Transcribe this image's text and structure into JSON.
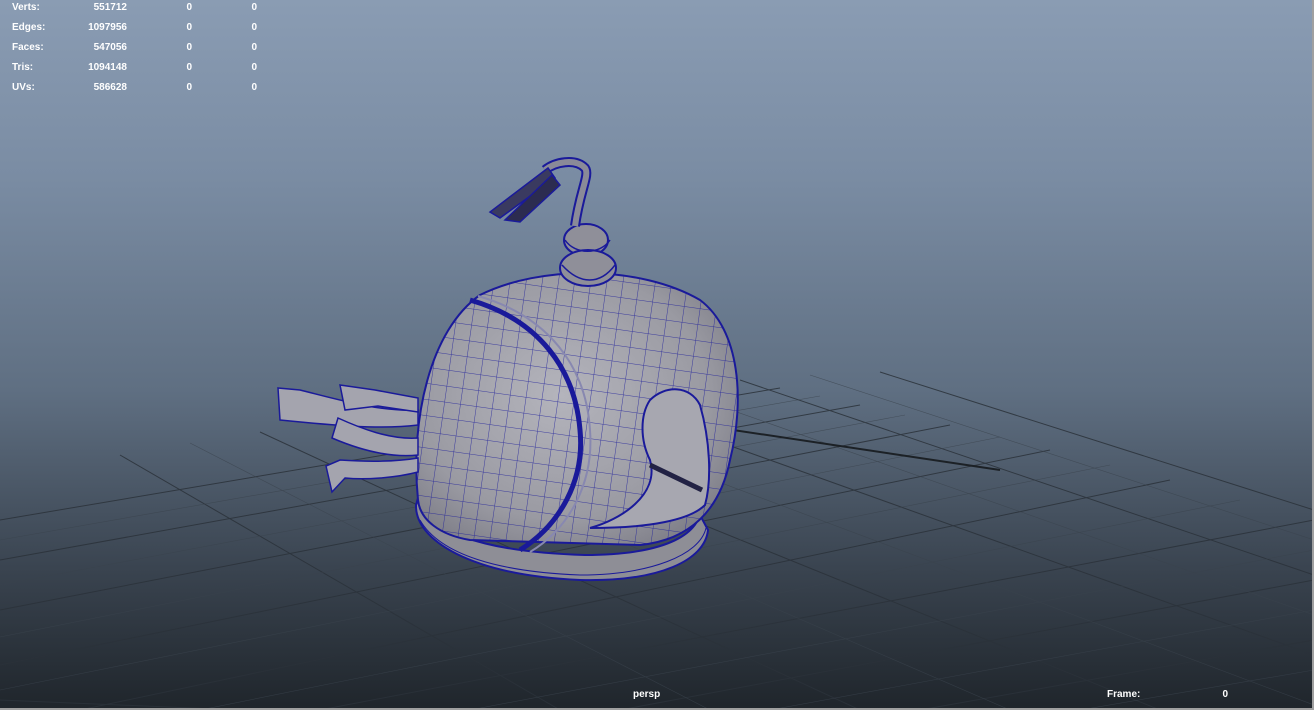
{
  "hud": {
    "rows": [
      {
        "label": "Verts:",
        "v1": "551712",
        "v2": "0",
        "v3": "0"
      },
      {
        "label": "Edges:",
        "v1": "1097956",
        "v2": "0",
        "v3": "0"
      },
      {
        "label": "Faces:",
        "v1": "547056",
        "v2": "0",
        "v3": "0"
      },
      {
        "label": "Tris:",
        "v1": "1094148",
        "v2": "0",
        "v3": "0"
      },
      {
        "label": "UVs:",
        "v1": "586628",
        "v2": "0",
        "v3": "0"
      }
    ]
  },
  "viewport": {
    "camera": "persp",
    "frame_label": "Frame:",
    "frame_value": "0"
  },
  "colors": {
    "wireframe": "#1a1a9a",
    "mesh_fill": "#9a9aa2",
    "grid": "#2a3038"
  }
}
